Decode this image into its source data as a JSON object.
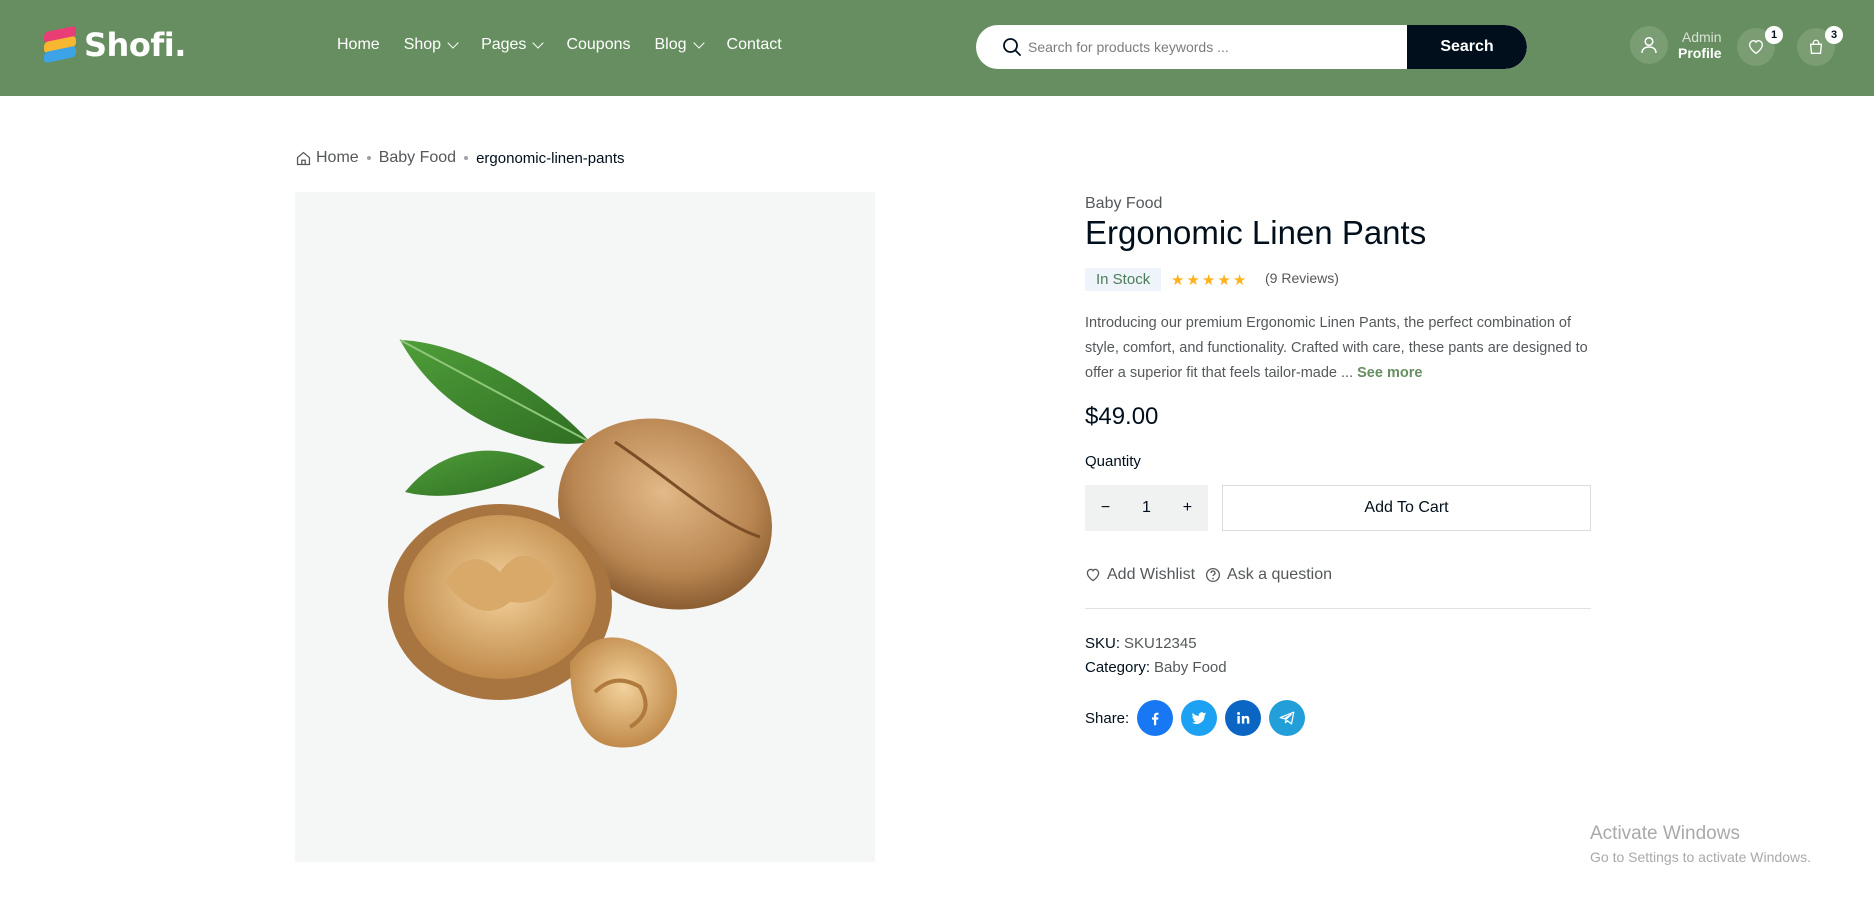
{
  "brand": {
    "name": "Shofi",
    "dot": "."
  },
  "nav": {
    "items": [
      {
        "label": "Home",
        "dropdown": false
      },
      {
        "label": "Shop",
        "dropdown": true
      },
      {
        "label": "Pages",
        "dropdown": true
      },
      {
        "label": "Coupons",
        "dropdown": false
      },
      {
        "label": "Blog",
        "dropdown": true
      },
      {
        "label": "Contact",
        "dropdown": false
      }
    ]
  },
  "search": {
    "placeholder": "Search for products keywords ...",
    "button_label": "Search"
  },
  "profile": {
    "small": "Admin",
    "big": "Profile"
  },
  "wishlist_count": "1",
  "cart_count": "3",
  "breadcrumb": {
    "home": "Home",
    "category": "Baby Food",
    "current": "ergonomic-linen-pants"
  },
  "product": {
    "category": "Baby Food",
    "title": "Ergonomic Linen Pants",
    "stock": "In Stock",
    "rating": 5,
    "reviews": "(9 Reviews)",
    "description": "Introducing our premium Ergonomic Linen Pants, the perfect combination of style, comfort, and functionality. Crafted with care, these pants are designed to offer a superior fit that feels tailor-made ...",
    "see_more": "See more",
    "price": "$49.00",
    "quantity_label": "Quantity",
    "quantity": "1",
    "add_to_cart": "Add To Cart",
    "add_wishlist": "Add Wishlist",
    "ask_question": "Ask a question",
    "sku_label": "SKU:",
    "sku": "SKU12345",
    "category_label": "Category:",
    "category_value": "Baby Food",
    "share_label": "Share:"
  },
  "watermark": {
    "line1": "Activate Windows",
    "line2": "Go to Settings to activate Windows."
  },
  "colors": {
    "header": "#678e61",
    "dark": "#010f1c",
    "facebook": "#1877f2",
    "twitter": "#1da1f2",
    "linkedin": "#0a66c2",
    "telegram": "#229ed9"
  }
}
